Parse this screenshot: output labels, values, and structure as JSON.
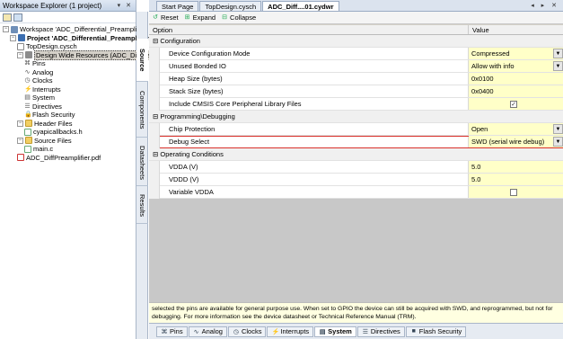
{
  "workspace": {
    "title": "Workspace Explorer (1 project)",
    "controls": "▾ ✕",
    "tree": [
      {
        "label": "Workspace 'ADC_Differential_Preamplifier'",
        "icon": "workspace-icon",
        "level": 0
      },
      {
        "label": "Project 'ADC_Differential_Preamplifier'",
        "icon": "project-icon",
        "level": 1,
        "bold": true
      },
      {
        "label": "TopDesign.cysch",
        "icon": "schematic-file-icon",
        "level": 2
      },
      {
        "label": "Design Wide Resources (ADC_Differential_Preamplifier.cydwr)",
        "icon": "resources-icon",
        "level": 2,
        "selected": true
      },
      {
        "label": "Pins",
        "icon": "pins-icon",
        "level": 3
      },
      {
        "label": "Analog",
        "icon": "analog-icon",
        "level": 3
      },
      {
        "label": "Clocks",
        "icon": "clocks-icon",
        "level": 3
      },
      {
        "label": "Interrupts",
        "icon": "interrupts-icon",
        "level": 3
      },
      {
        "label": "System",
        "icon": "system-icon",
        "level": 3
      },
      {
        "label": "Directives",
        "icon": "directives-icon",
        "level": 3
      },
      {
        "label": "Flash Security",
        "icon": "flash-security-icon",
        "level": 3
      },
      {
        "label": "Header Files",
        "icon": "folder-icon",
        "level": 2
      },
      {
        "label": "cyapicallbacks.h",
        "icon": "header-file-icon",
        "level": 3
      },
      {
        "label": "Source Files",
        "icon": "folder-icon",
        "level": 2
      },
      {
        "label": "main.c",
        "icon": "c-file-icon",
        "level": 3
      },
      {
        "label": "ADC_DiffPreamplifier.pdf",
        "icon": "pdf-file-icon",
        "level": 2
      }
    ]
  },
  "side_tabs": [
    "Source",
    "Components",
    "Datasheets",
    "Results"
  ],
  "doc_tabs": [
    {
      "label": "Start Page"
    },
    {
      "label": "TopDesign.cysch"
    },
    {
      "label": "ADC_Diff....01.cydwr",
      "active": true
    }
  ],
  "doc_controls": "◂ ▸ ✕",
  "toolbar": {
    "reset": "Reset",
    "expand": "Expand",
    "collapse": "Collapse"
  },
  "grid": {
    "col_option": "Option",
    "col_value": "Value",
    "rows": [
      {
        "type": "category",
        "name": "Configuration"
      },
      {
        "type": "prop",
        "name": "Device Configuration Mode",
        "value": "Compressed",
        "dropdown": true
      },
      {
        "type": "prop",
        "name": "Unused Bonded IO",
        "value": "Allow with info",
        "dropdown": true
      },
      {
        "type": "prop",
        "name": "Heap Size (bytes)",
        "value": "0x0100"
      },
      {
        "type": "prop",
        "name": "Stack Size (bytes)",
        "value": "0x0400"
      },
      {
        "type": "prop",
        "name": "Include CMSIS Core Peripheral Library Files",
        "checkbox": true,
        "checked": true
      },
      {
        "type": "category",
        "name": "Programming\\Debugging"
      },
      {
        "type": "prop",
        "name": "Chip Protection",
        "value": "Open",
        "dropdown": true
      },
      {
        "type": "prop",
        "name": "Debug Select",
        "value": "SWD (serial wire debug)",
        "dropdown": true,
        "highlight": true
      },
      {
        "type": "category",
        "name": "Operating Conditions"
      },
      {
        "type": "prop",
        "name": "VDDA (V)",
        "value": "5.0"
      },
      {
        "type": "prop",
        "name": "VDDD (V)",
        "value": "5.0"
      },
      {
        "type": "prop",
        "name": "Variable VDDA",
        "checkbox": true,
        "checked": false
      }
    ]
  },
  "description": "selected the pins are available for general purpose use. When set to GPIO the device can still be acquired with SWD, and reprogrammed, but not for debugging. For more information see the device datasheet or Technical Reference Manual (TRM).",
  "bottom_tabs": [
    {
      "label": "Pins",
      "icon": "pins-icon"
    },
    {
      "label": "Analog",
      "icon": "analog-icon"
    },
    {
      "label": "Clocks",
      "icon": "clocks-icon"
    },
    {
      "label": "Interrupts",
      "icon": "interrupts-icon"
    },
    {
      "label": "System",
      "icon": "system-icon",
      "active": true
    },
    {
      "label": "Directives",
      "icon": "directives-icon"
    },
    {
      "label": "Flash Security",
      "icon": "flash-security-icon"
    }
  ]
}
